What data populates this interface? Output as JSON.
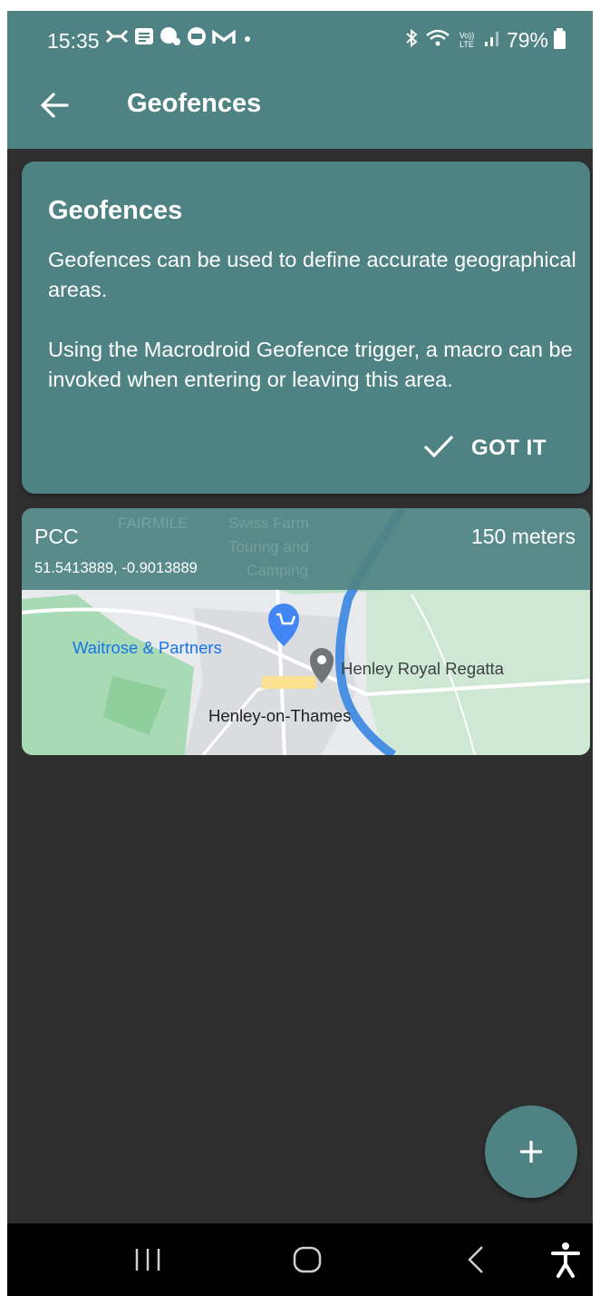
{
  "status_bar": {
    "time": "15:35",
    "notification_icons": [
      "halifax-icon",
      "news-icon",
      "chat-icon",
      "amex-icon",
      "gmail-icon",
      "dot-icon"
    ],
    "right_icons": [
      "bluetooth-icon",
      "wifi-icon",
      "volte-icon",
      "signal-icon"
    ],
    "volte_label": "Vo)) LTE",
    "battery": "79%"
  },
  "app_bar": {
    "title": "Geofences",
    "back_icon": "arrow-back-icon"
  },
  "info_card": {
    "title": "Geofences",
    "paragraph_1": "Geofences can be used to define accurate geographical areas.",
    "paragraph_2": "Using the Macrodroid Geofence trigger, a macro can be invoked when entering or leaving this area.",
    "button_label": "GOT IT",
    "button_icon": "check-icon"
  },
  "geofences": [
    {
      "name": "PCC",
      "coordinates": "51.5413889, -0.9013889",
      "radius": "150 meters",
      "map_labels": {
        "shop": "Waitrose & Partners",
        "venue": "Henley Royal Regatta",
        "town": "Henley-on-Thames",
        "faint_1": "FAIRMILE",
        "faint_2": "Swiss Farm",
        "faint_3": "Touring and",
        "faint_4": "Camping"
      }
    }
  ],
  "fab": {
    "icon": "plus-icon"
  },
  "nav_bar": {
    "buttons": [
      "recents-icon",
      "home-icon",
      "back-icon",
      "accessibility-icon"
    ]
  },
  "colors": {
    "primary": "#4f8383",
    "background": "#2f2f2f",
    "nav_bar": "#000000",
    "text": "#ffffff",
    "map_green": "#aedcb4",
    "map_river": "#4a90e2"
  }
}
